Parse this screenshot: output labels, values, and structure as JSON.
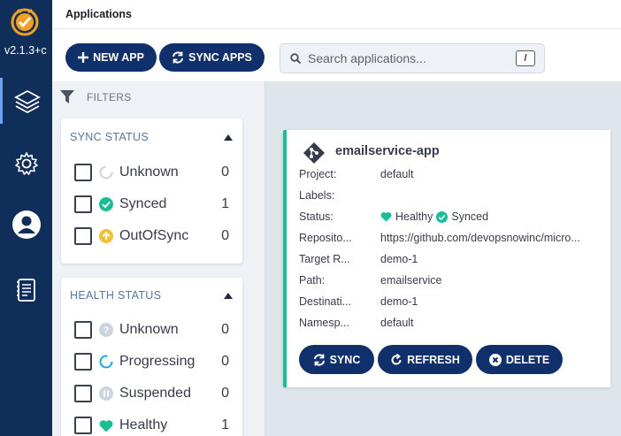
{
  "nav": {
    "version": "v2.1.3+c",
    "items": [
      {
        "icon": "layers-icon"
      },
      {
        "icon": "gear-icon"
      },
      {
        "icon": "user-icon"
      },
      {
        "icon": "docs-icon"
      }
    ]
  },
  "header": {
    "title": "Applications",
    "new_app_label": "NEW APP",
    "sync_apps_label": "SYNC APPS",
    "search_placeholder": "Search applications...",
    "search_shortcut": "/"
  },
  "filters": {
    "heading": "FILTERS",
    "sync_status": {
      "title": "SYNC STATUS",
      "items": [
        {
          "label": "Unknown",
          "count": "0"
        },
        {
          "label": "Synced",
          "count": "1"
        },
        {
          "label": "OutOfSync",
          "count": "0"
        }
      ]
    },
    "health_status": {
      "title": "HEALTH STATUS",
      "items": [
        {
          "label": "Unknown",
          "count": "0"
        },
        {
          "label": "Progressing",
          "count": "0"
        },
        {
          "label": "Suspended",
          "count": "0"
        },
        {
          "label": "Healthy",
          "count": "1"
        }
      ]
    }
  },
  "app": {
    "name": "emailservice-app",
    "fields": {
      "project_key": "Project:",
      "project": "default",
      "labels_key": "Labels:",
      "labels": "",
      "status_key": "Status:",
      "health": "Healthy",
      "sync": "Synced",
      "repo_key": "Reposito...",
      "repo": "https://github.com/devopsnowinc/micro...",
      "target_key": "Target R...",
      "target": "demo-1",
      "path_key": "Path:",
      "path": "emailservice",
      "dest_key": "Destinati...",
      "dest": "demo-1",
      "ns_key": "Namesp...",
      "ns": "default"
    },
    "actions": {
      "sync": "SYNC",
      "refresh": "REFRESH",
      "delete": "DELETE"
    }
  },
  "colors": {
    "nav": "#0f2e5a",
    "accent": "#10306b",
    "healthy": "#18be94",
    "warning": "#f4c030"
  }
}
